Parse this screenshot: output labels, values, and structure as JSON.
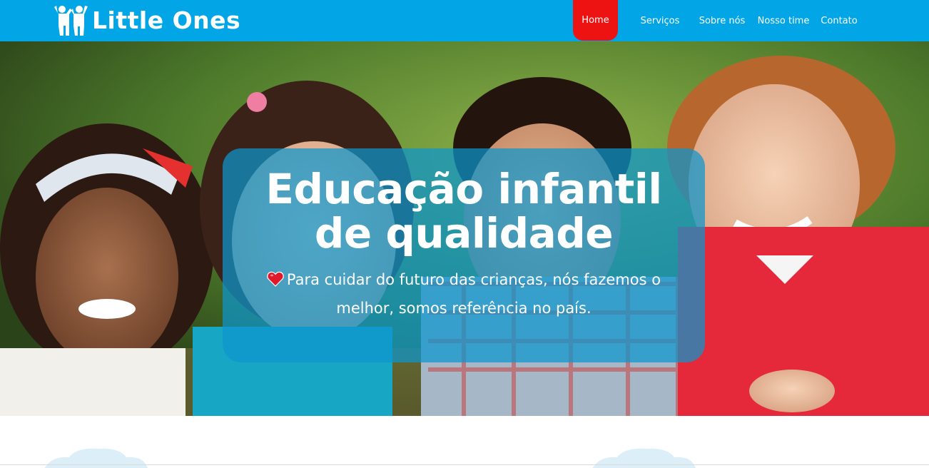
{
  "brand": {
    "name": "Little Ones",
    "icon": "two-children-icon"
  },
  "nav": {
    "items": [
      {
        "label": "Home",
        "active": true
      },
      {
        "label": "Serviços",
        "active": false
      },
      {
        "label": "Sobre nós",
        "active": false
      },
      {
        "label": "Nosso time",
        "active": false
      },
      {
        "label": "Contato",
        "active": false
      }
    ]
  },
  "hero": {
    "title_line1": "Educação infantil",
    "title_line2": "de qualidade",
    "subtitle": "Para cuidar do futuro das crianças, nós fazemos o melhor, somos referência no país.",
    "subtitle_icon": "heart-icon"
  },
  "colors": {
    "navbar": "#02a5e5",
    "active_nav": "#ee1313",
    "hero_card": "#0c96cd",
    "text": "#ffffff"
  }
}
